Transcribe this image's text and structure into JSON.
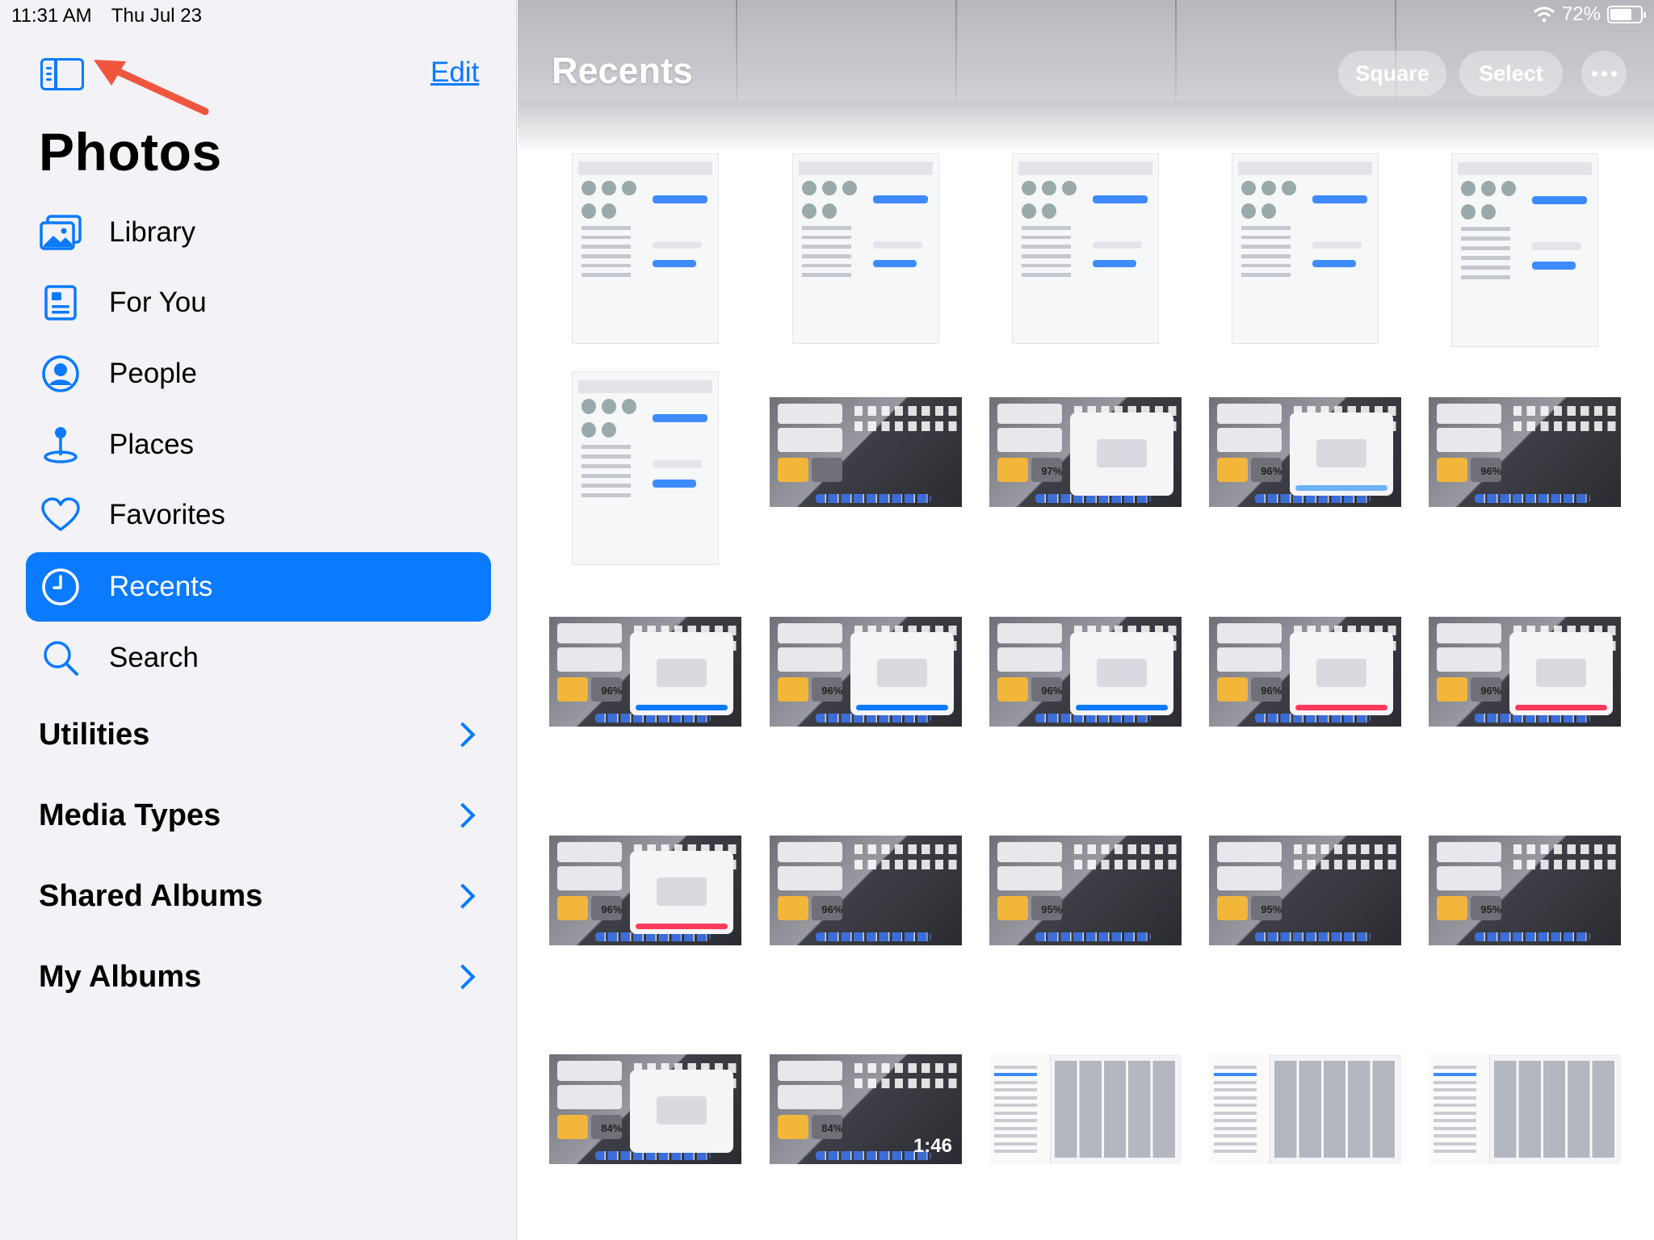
{
  "status_bar": {
    "time": "11:31 AM",
    "date": "Thu Jul 23",
    "battery": "72%",
    "battery_level": 0.72
  },
  "sidebar": {
    "edit_label": "Edit",
    "title": "Photos",
    "items": [
      {
        "label": "Library",
        "icon": "photo-library-icon"
      },
      {
        "label": "For You",
        "icon": "for-you-icon"
      },
      {
        "label": "People",
        "icon": "person-circle-icon"
      },
      {
        "label": "Places",
        "icon": "map-pin-icon"
      },
      {
        "label": "Favorites",
        "icon": "heart-icon"
      },
      {
        "label": "Recents",
        "icon": "clock-icon",
        "selected": true
      },
      {
        "label": "Search",
        "icon": "search-icon"
      }
    ],
    "sections": [
      {
        "label": "Utilities"
      },
      {
        "label": "Media Types"
      },
      {
        "label": "Shared Albums"
      },
      {
        "label": "My Albums"
      }
    ]
  },
  "main": {
    "title": "Recents",
    "square_label": "Square",
    "select_label": "Select",
    "thumbnail_labels": {
      "pct_96": "96%",
      "pct_97": "97%",
      "pct_95": "95%",
      "pct_84": "84%",
      "video_duration": "1:46"
    }
  },
  "colors": {
    "accent": "#0a7aff",
    "annotation_arrow": "#f0553d",
    "sidebar_bg": "#f2f2f7"
  }
}
